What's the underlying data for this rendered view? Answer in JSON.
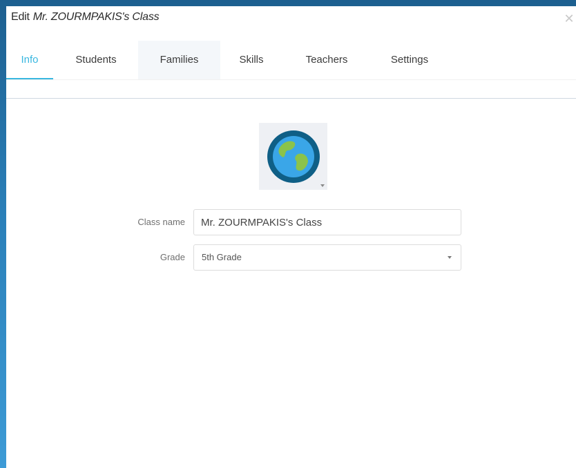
{
  "dialog": {
    "title_prefix": "Edit",
    "title_class": "Mr. ZOURMPAKIS's Class",
    "close_icon": "close-icon"
  },
  "tabs": [
    {
      "label": "Info",
      "active": true
    },
    {
      "label": "Students",
      "active": false
    },
    {
      "label": "Families",
      "active": false
    },
    {
      "label": "Skills",
      "active": false
    },
    {
      "label": "Teachers",
      "active": false
    },
    {
      "label": "Settings",
      "active": false
    }
  ],
  "avatar": {
    "icon": "globe-icon",
    "colors": {
      "ring": "#0f5f86",
      "ocean": "#3aa6e8",
      "land": "#8bc34a"
    }
  },
  "form": {
    "class_name_label": "Class name",
    "class_name_value": "Mr. ZOURMPAKIS's Class",
    "grade_label": "Grade",
    "grade_value": "5th Grade"
  },
  "colors": {
    "accent": "#38b7e0",
    "background": "#2a7fb8"
  }
}
